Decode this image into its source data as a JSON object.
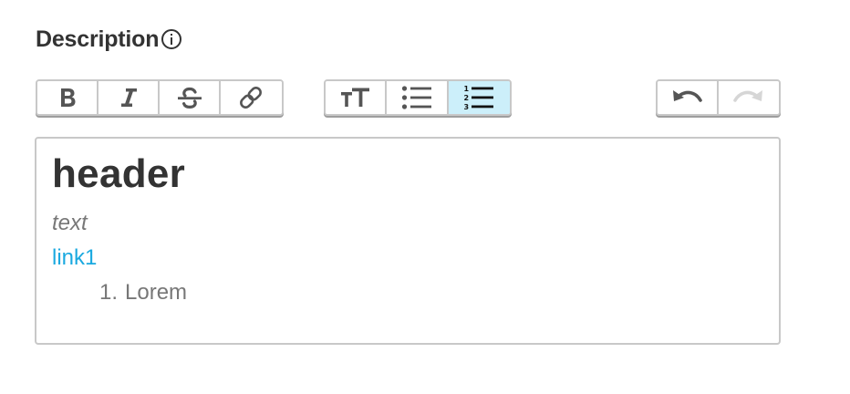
{
  "field": {
    "label": "Description",
    "info_icon": "info-circle-icon"
  },
  "toolbar": {
    "format_group": [
      {
        "name": "bold",
        "icon": "bold-icon",
        "active": false
      },
      {
        "name": "italic",
        "icon": "italic-icon",
        "active": false
      },
      {
        "name": "strikethrough",
        "icon": "strikethrough-icon",
        "active": false
      },
      {
        "name": "link",
        "icon": "link-icon",
        "active": false
      }
    ],
    "block_group": [
      {
        "name": "heading",
        "icon": "text-size-icon",
        "active": false
      },
      {
        "name": "bulleted-list",
        "icon": "bulleted-list-icon",
        "active": false
      },
      {
        "name": "numbered-list",
        "icon": "numbered-list-icon",
        "active": true
      }
    ],
    "history_group": [
      {
        "name": "undo",
        "icon": "undo-icon",
        "enabled": true
      },
      {
        "name": "redo",
        "icon": "redo-icon",
        "enabled": false
      }
    ],
    "active_color": "#cceffa"
  },
  "editor": {
    "header": "header",
    "italic_text": "text",
    "link_text": "link1",
    "list_items": [
      {
        "number": "1.",
        "text": "Lorem"
      }
    ],
    "link_color": "#1aa9e0",
    "text_color": "#777777"
  }
}
